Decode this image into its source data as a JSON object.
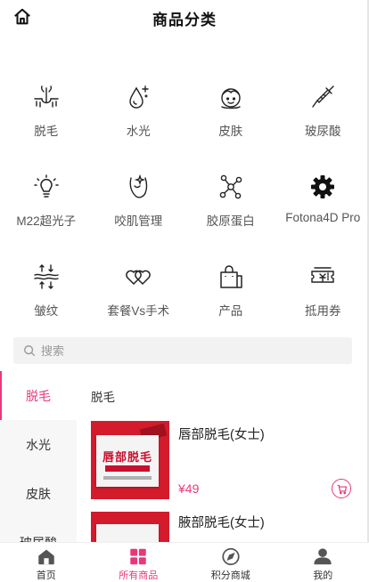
{
  "header": {
    "title": "商品分类",
    "home_icon": "home-icon"
  },
  "categories": [
    {
      "label": "脱毛",
      "icon": "hair-follicle-icon"
    },
    {
      "label": "水光",
      "icon": "water-drop-icon"
    },
    {
      "label": "皮肤",
      "icon": "face-icon"
    },
    {
      "label": "玻尿酸",
      "icon": "syringe-icon"
    },
    {
      "label": "M22超光子",
      "icon": "light-bulb-icon"
    },
    {
      "label": "咬肌管理",
      "icon": "jaw-icon"
    },
    {
      "label": "胶原蛋白",
      "icon": "molecule-icon"
    },
    {
      "label": "Fotona4D Pro",
      "icon": "gear-icon"
    },
    {
      "label": "皱纹",
      "icon": "wrinkle-icon"
    },
    {
      "label": "套餐Vs手术",
      "icon": "hearts-icon"
    },
    {
      "label": "产品",
      "icon": "shopping-bag-icon"
    },
    {
      "label": "抵用券",
      "icon": "coupon-icon"
    }
  ],
  "search": {
    "placeholder": "搜索"
  },
  "sidebar": {
    "items": [
      "脱毛",
      "水光",
      "皮肤",
      "玻尿酸"
    ],
    "active_index": 0
  },
  "section": {
    "title": "脱毛"
  },
  "products": [
    {
      "name": "唇部脱毛(女士)",
      "price": "¥49",
      "thumb_text": "唇部脱毛"
    },
    {
      "name": "腋部脱毛(女士)"
    }
  ],
  "tabbar": [
    {
      "label": "首页",
      "icon": "home-icon"
    },
    {
      "label": "所有商品",
      "icon": "grid-icon",
      "active": true
    },
    {
      "label": "积分商城",
      "icon": "compass-icon"
    },
    {
      "label": "我的",
      "icon": "user-icon"
    }
  ],
  "colors": {
    "accent": "#e8387a",
    "sidebar_bg": "#f7f7f7",
    "search_bg": "#f2f2f2"
  }
}
